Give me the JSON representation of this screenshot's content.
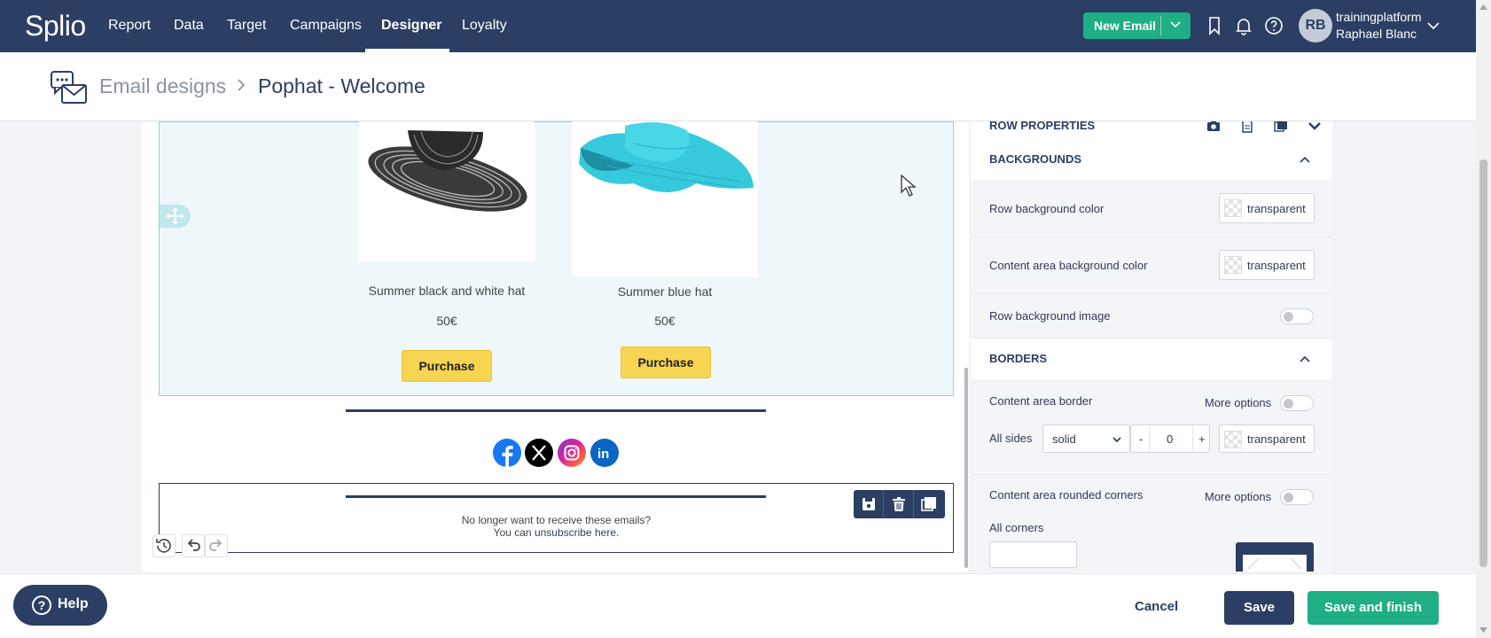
{
  "nav": {
    "logo": "Splio",
    "items": [
      "Report",
      "Data",
      "Target",
      "Campaigns",
      "Designer",
      "Loyalty"
    ],
    "active": "Designer",
    "new_email": "New Email",
    "user": {
      "initials": "RB",
      "org": "trainingplatform",
      "name": "Raphael Blanc"
    }
  },
  "breadcrumb": {
    "parent": "Email designs",
    "current": "Pophat - Welcome"
  },
  "canvas": {
    "products": [
      {
        "name": "Summer black and white hat",
        "price": "50€",
        "button": "Purchase"
      },
      {
        "name": "Summer blue hat",
        "price": "50€",
        "button": "Purchase"
      }
    ],
    "socials": [
      "facebook-icon",
      "x-icon",
      "instagram-icon",
      "linkedin-icon"
    ],
    "footer_line1": "No longer want to receive these emails?",
    "footer_line2_prefix": "You can ",
    "footer_link": "unsubscribe here."
  },
  "panel": {
    "header": "ROW PROPERTIES",
    "backgrounds": {
      "title": "BACKGROUNDS",
      "row_bg_color_label": "Row background color",
      "row_bg_color_value": "transparent",
      "content_bg_color_label": "Content area background color",
      "content_bg_color_value": "transparent",
      "row_bg_image_label": "Row background image"
    },
    "borders": {
      "title": "BORDERS",
      "content_border_label": "Content area border",
      "more_options": "More options",
      "all_sides_label": "All sides",
      "border_style": "solid",
      "border_width": "0",
      "border_color": "transparent",
      "rounded_label": "Content area rounded corners",
      "more_options_2": "More options",
      "all_corners_label": "All corners"
    }
  },
  "footer_bar": {
    "help": "Help",
    "cancel": "Cancel",
    "save": "Save",
    "save_finish": "Save and finish"
  },
  "colors": {
    "navy": "#2b3e63",
    "green": "#1fae86",
    "purchase_yellow": "#f7d452",
    "selected_row_bg": "#eef8fa"
  }
}
